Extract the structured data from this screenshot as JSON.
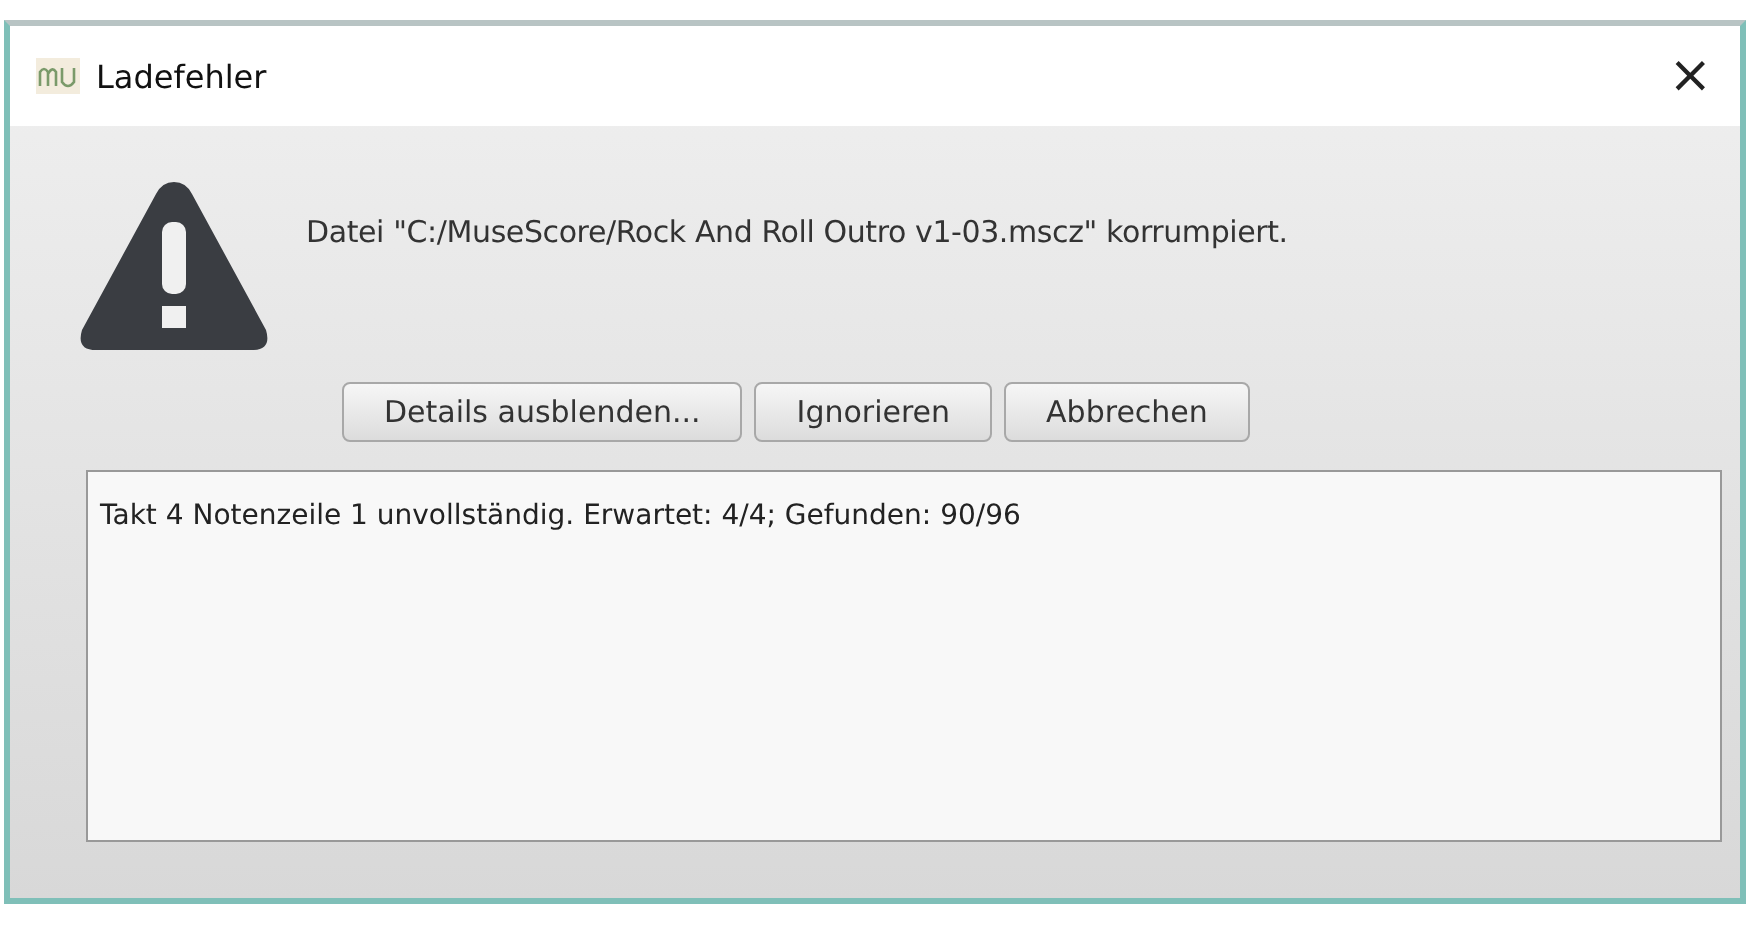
{
  "window": {
    "title": "Ladefehler",
    "close": "×"
  },
  "message": "Datei \"C:/MuseScore/Rock And Roll Outro v1-03.mscz\" korrumpiert.",
  "buttons": [
    "Details ausblenden...",
    "Ignorieren",
    "Abbrechen"
  ],
  "details": "Takt 4 Notenzeile 1 unvollständig. Erwartet: 4/4; Gefunden: 90/96"
}
